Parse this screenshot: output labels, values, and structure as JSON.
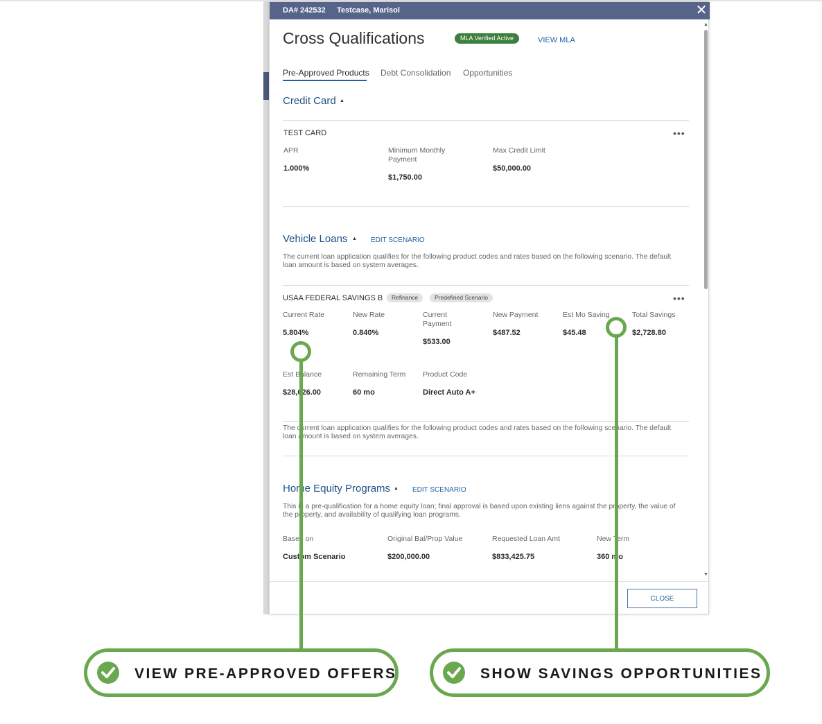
{
  "header": {
    "da_number": "DA# 242532",
    "applicant": "Testcase, Marisol"
  },
  "title": "Cross Qualifications",
  "mla_badge": "MLA Verified Active",
  "view_mla": "VIEW MLA",
  "tabs": [
    "Pre-Approved Products",
    "Debt Consolidation",
    "Opportunities"
  ],
  "active_tab": "Pre-Approved Products",
  "credit_card": {
    "section_title": "Credit Card",
    "product": "TEST CARD",
    "fields": [
      {
        "label": "APR",
        "value": "1.000%"
      },
      {
        "label": "Minimum Monthly Payment",
        "value": "$1,750.00"
      },
      {
        "label": "Max Credit Limit",
        "value": "$50,000.00"
      }
    ]
  },
  "vehicle_loans": {
    "section_title": "Vehicle Loans",
    "edit_label": "EDIT SCENARIO",
    "description": "The current loan application qualifies for the following product codes and rates based on the following scenario. The default loan amount is based on system averages.",
    "product": "USAA FEDERAL SAVINGS B",
    "tags": [
      "Refinance",
      "Predefined Scenario"
    ],
    "fields": [
      {
        "label": "Current Rate",
        "value": "5.804%"
      },
      {
        "label": "New Rate",
        "value": "0.840%"
      },
      {
        "label": "Current Payment",
        "value": "$533.00"
      },
      {
        "label": "New Payment",
        "value": "$487.52"
      },
      {
        "label": "Est Mo Saving",
        "value": "$45.48"
      },
      {
        "label": "Total Savings",
        "value": "$2,728.80"
      },
      {
        "label": "Est Balance",
        "value": "$28,626.00"
      },
      {
        "label": "Remaining Term",
        "value": "60 mo"
      },
      {
        "label": "Product Code",
        "value": "Direct Auto A+"
      }
    ],
    "description_2": "The current loan application qualifies for the following product codes and rates based on the following scenario. The default loan amount is based on system averages."
  },
  "home_equity": {
    "section_title": "Home Equity Programs",
    "edit_label": "EDIT SCENARIO",
    "description": "This is a pre-qualification for a home equity loan; final approval is based upon existing liens against the property, the value of the property, and availability of qualifying loan programs.",
    "fields": [
      {
        "label": "Based on",
        "value": "Custom Scenario"
      },
      {
        "label": "Original Bal/Prop Value",
        "value": "$200,000.00"
      },
      {
        "label": "Requested Loan Amt",
        "value": "$833,425.75"
      },
      {
        "label": "New Term",
        "value": "360 mo"
      }
    ]
  },
  "close_label": "CLOSE",
  "callouts": [
    "VIEW PRE-APPROVED OFFERS",
    "SHOW SAVINGS OPPORTUNITIES"
  ],
  "colors": {
    "header": "#56648a",
    "accent_blue": "#1f5f9f",
    "badge_green": "#3d7f3d",
    "annotation_green": "#6aa84f"
  }
}
